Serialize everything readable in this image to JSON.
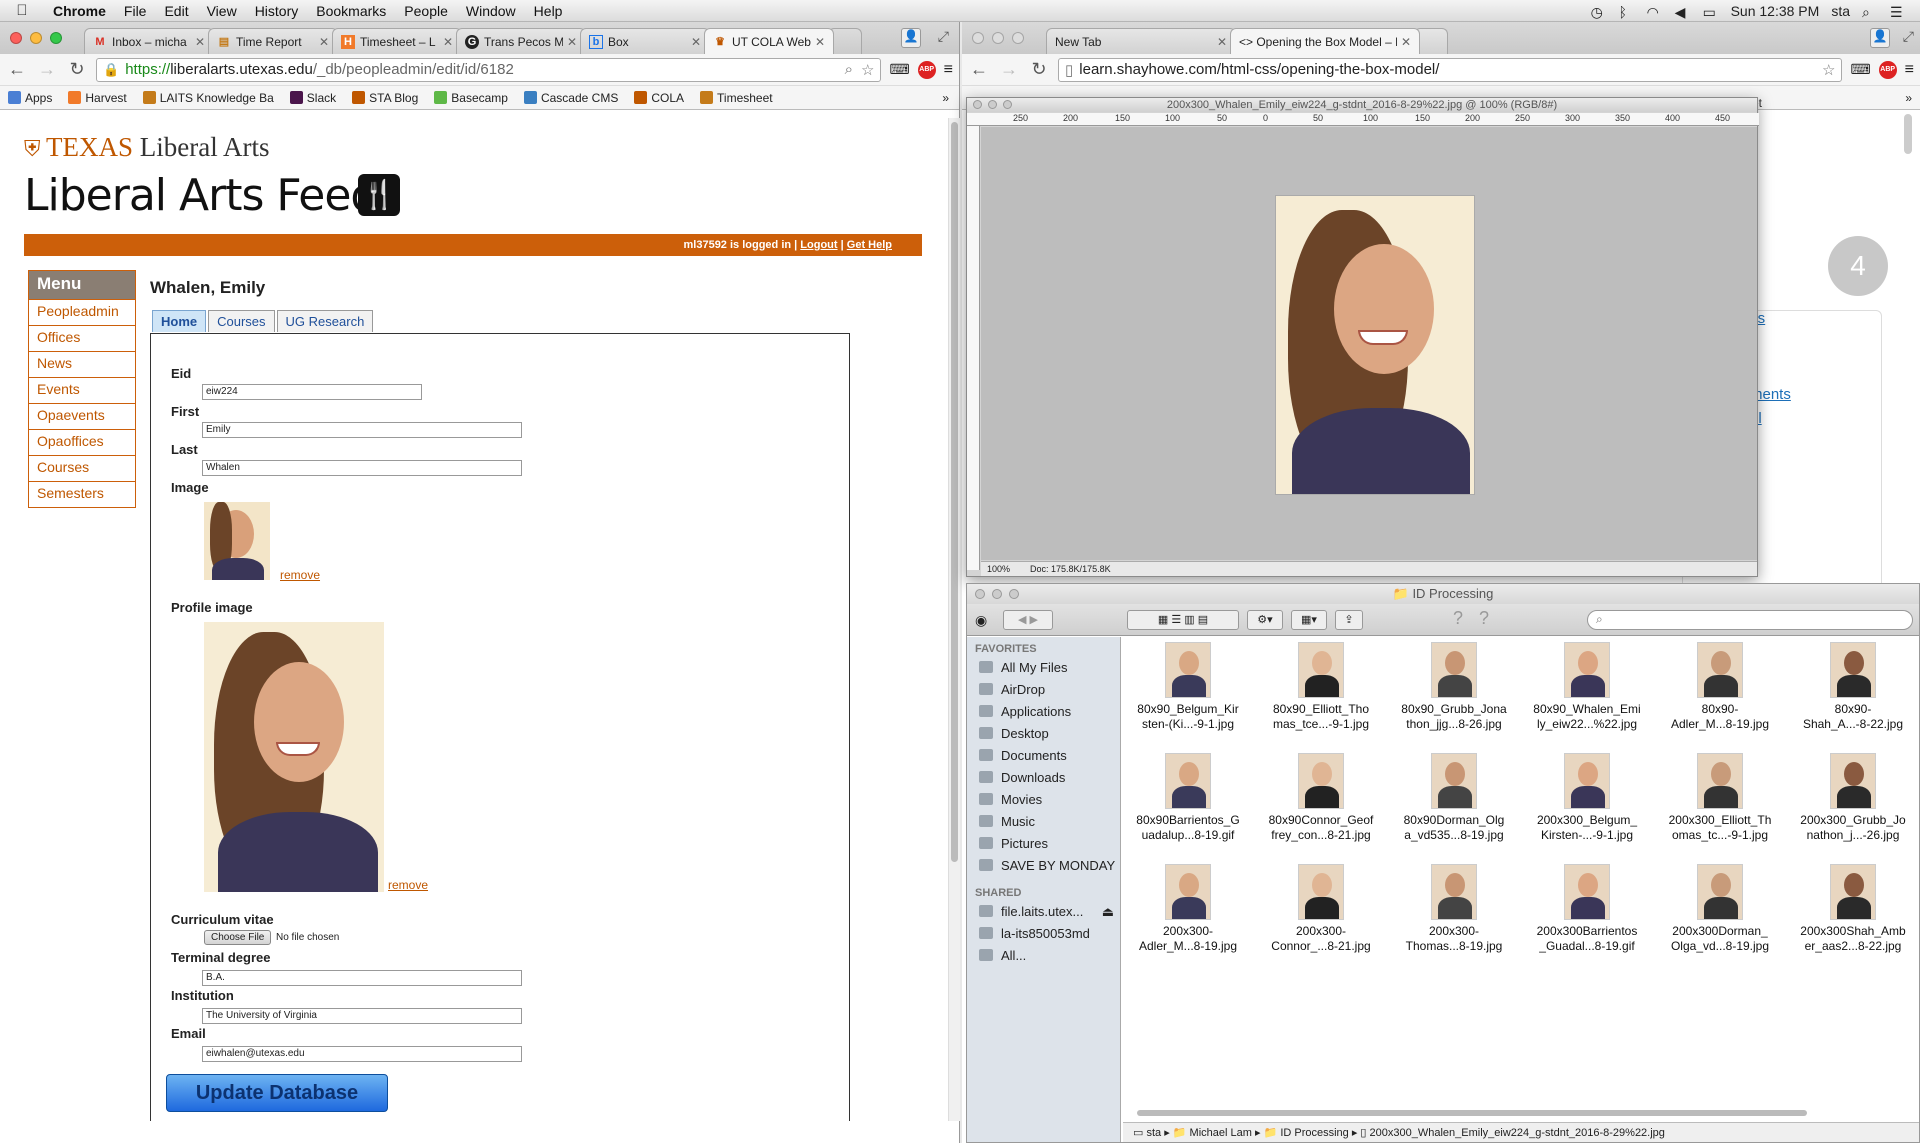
{
  "menubar": {
    "app": "Chrome",
    "items": [
      "File",
      "Edit",
      "View",
      "History",
      "Bookmarks",
      "People",
      "Window",
      "Help"
    ],
    "clock": "Sun 12:38 PM",
    "user": "sta"
  },
  "left_browser": {
    "tabs": [
      {
        "label": "Inbox – micha",
        "fav": "M",
        "color": "#d93025"
      },
      {
        "label": "Time Report",
        "fav": "▤",
        "color": "#c47b1a"
      },
      {
        "label": "Timesheet – L",
        "fav": "H",
        "color": "#f17a2a"
      },
      {
        "label": "Trans Pecos M",
        "fav": "G",
        "color": "#333"
      },
      {
        "label": "Box",
        "fav": "b",
        "color": "#1a73e8"
      },
      {
        "label": "UT COLA Web",
        "fav": "♛",
        "color": "#bf5700"
      }
    ],
    "url_prefix": "https://",
    "url_host": "liberalarts.utexas.edu",
    "url_path": "/_db/peopleadmin/edit/id/6182",
    "bookmarks": [
      {
        "label": "Apps",
        "color": "#4a7fd4"
      },
      {
        "label": "Harvest",
        "color": "#f17a2a"
      },
      {
        "label": "LAITS Knowledge Ba",
        "color": "#c47b1a"
      },
      {
        "label": "Slack",
        "color": "#4a154b"
      },
      {
        "label": "STA Blog",
        "color": "#bf5700"
      },
      {
        "label": "Basecamp",
        "color": "#5eb847"
      },
      {
        "label": "Cascade CMS",
        "color": "#3a7fc1"
      },
      {
        "label": "COLA",
        "color": "#bf5700"
      },
      {
        "label": "Timesheet",
        "color": "#c47b1a"
      }
    ]
  },
  "site": {
    "brand_texas": "TEXAS",
    "brand_la": " Liberal Arts",
    "feed_title": "Liberal Arts Feed",
    "status_prefix": "ml37592 is logged in | ",
    "logout": "Logout",
    "sep": " | ",
    "help": "Get Help",
    "menu_title": "Menu",
    "menu_items": [
      "Peopleadmin",
      "Offices",
      "News",
      "Events",
      "Opaevents",
      "Opaoffices",
      "Courses",
      "Semesters"
    ]
  },
  "person": {
    "name": "Whalen, Emily",
    "tabs": [
      "Home",
      "Courses",
      "UG Research"
    ],
    "fields": {
      "eid_label": "Eid",
      "eid": "eiw224",
      "first_label": "First",
      "first": "Emily",
      "last_label": "Last",
      "last": "Whalen",
      "image_label": "Image",
      "profile_label": "Profile image",
      "remove": "remove",
      "cv_label": "Curriculum vitae",
      "choose_file": "Choose File",
      "no_file": "No file chosen",
      "degree_label": "Terminal degree",
      "degree": "B.A.",
      "inst_label": "Institution",
      "inst": "The University of Virginia",
      "email_label": "Email",
      "email": "eiwhalen@utexas.edu"
    },
    "update_button": "Update Database"
  },
  "right_browser": {
    "tabs": [
      {
        "label": "New Tab"
      },
      {
        "label": "<> Opening the Box Model – L"
      }
    ],
    "url": "learn.shayhowe.com/html-css/opening-the-box-model/",
    "step_number": "4",
    "link1": "ols",
    "link2": "ments",
    "link3": "el",
    "cut_text": "et"
  },
  "photoshop": {
    "title": "200x300_Whalen_Emily_eiw224_g-stdnt_2016-8-29%22.jpg @ 100% (RGB/8#)",
    "zoom": "100%",
    "doc": "Doc: 175.8K/175.8K",
    "ruler_ticks": [
      "250",
      "200",
      "150",
      "100",
      "50",
      "0",
      "50",
      "100",
      "150",
      "200",
      "250",
      "300",
      "350",
      "400",
      "450"
    ]
  },
  "finder": {
    "title": "ID Processing",
    "favorites_label": "FAVORITES",
    "favorites": [
      "All My Files",
      "AirDrop",
      "Applications",
      "Desktop",
      "Documents",
      "Downloads",
      "Movies",
      "Music",
      "Pictures",
      "SAVE BY MONDAY"
    ],
    "shared_label": "SHARED",
    "shared": [
      "file.laits.utex...",
      "la-its850053md",
      "All..."
    ],
    "files": [
      [
        "80x90_Belgum_Kir",
        "sten-(Ki...-9-1.jpg"
      ],
      [
        "80x90_Elliott_Tho",
        "mas_tce...-9-1.jpg"
      ],
      [
        "80x90_Grubb_Jona",
        "thon_jjg...8-26.jpg"
      ],
      [
        "80x90_Whalen_Emi",
        "ly_eiw22...%22.jpg"
      ],
      [
        "80x90-",
        "Adler_M...8-19.jpg"
      ],
      [
        "80x90-",
        "Shah_A...-8-22.jpg"
      ],
      [
        "80x90Barrientos_G",
        "uadalup...8-19.gif"
      ],
      [
        "80x90Connor_Geof",
        "frey_con...8-21.jpg"
      ],
      [
        "80x90Dorman_Olg",
        "a_vd535...8-19.jpg"
      ],
      [
        "200x300_Belgum_",
        "Kirsten-...-9-1.jpg"
      ],
      [
        "200x300_Elliott_Th",
        "omas_tc...-9-1.jpg"
      ],
      [
        "200x300_Grubb_Jo",
        "nathon_j...-26.jpg"
      ],
      [
        "200x300-",
        "Adler_M...8-19.jpg"
      ],
      [
        "200x300-",
        "Connor_...8-21.jpg"
      ],
      [
        "200x300-",
        "Thomas...8-19.jpg"
      ],
      [
        "200x300Barrientos",
        "_Guadal...8-19.gif"
      ],
      [
        "200x300Dorman_",
        "Olga_vd...8-19.jpg"
      ],
      [
        "200x300Shah_Amb",
        "er_aas2...8-22.jpg"
      ]
    ],
    "path": [
      "sta",
      "Michael Lam",
      "ID Processing",
      "200x300_Whalen_Emily_eiw224_g-stdnt_2016-8-29%22.jpg"
    ]
  },
  "colors": {
    "ut_orange": "#bf5700",
    "bar_orange": "#cc5f0a",
    "link_blue": "#1d6fb8"
  }
}
